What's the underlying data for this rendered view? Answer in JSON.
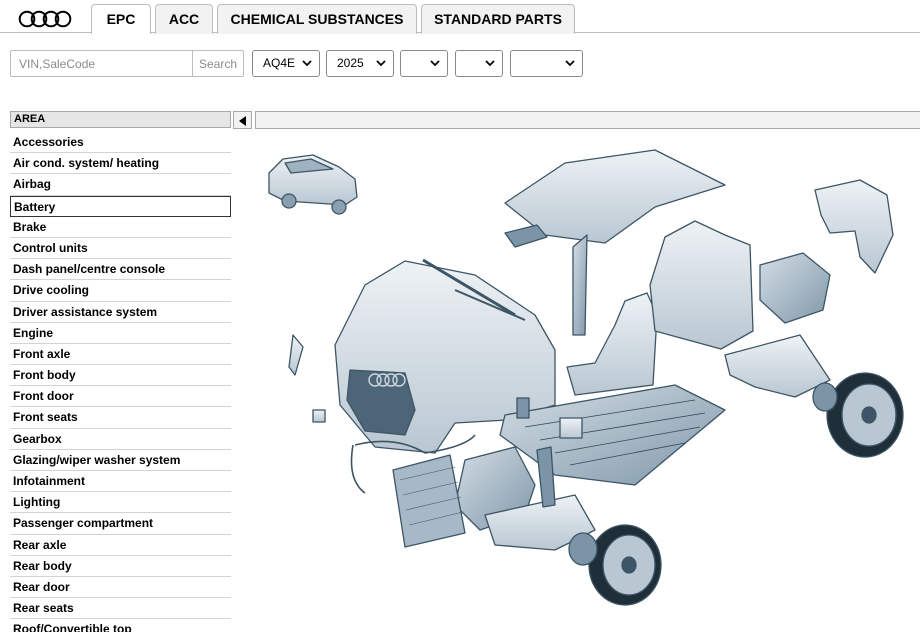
{
  "brand": {
    "logo_name": "four-rings-logo"
  },
  "tabs": [
    {
      "label": "EPC",
      "active": true
    },
    {
      "label": "ACC",
      "active": false
    },
    {
      "label": "CHEMICAL SUBSTANCES",
      "active": false
    },
    {
      "label": "STANDARD PARTS",
      "active": false
    }
  ],
  "search": {
    "placeholder": "VIN,SaleCode",
    "value": "",
    "button_label": "Search"
  },
  "filters": [
    {
      "value": "AQ4E"
    },
    {
      "value": "2025"
    },
    {
      "value": ""
    },
    {
      "value": ""
    },
    {
      "value": ""
    }
  ],
  "area": {
    "header": "AREA",
    "selected": "Battery",
    "items": [
      "Accessories",
      "Air cond. system/ heating",
      "Airbag",
      "Battery",
      "Brake",
      "Control units",
      "Dash panel/centre console",
      "Drive cooling",
      "Driver assistance system",
      "Engine",
      "Front axle",
      "Front body",
      "Front door",
      "Front seats",
      "Gearbox",
      "Glazing/wiper washer system",
      "Infotainment",
      "Lighting",
      "Passenger compartment",
      "Rear axle",
      "Rear body",
      "Rear door",
      "Rear seats",
      "Roof/Convertible top"
    ]
  },
  "colors": {
    "border": "#bdbdbd",
    "header_bg": "#e6e6e6",
    "part_fill": "#dfe6ec",
    "part_stroke": "#3d5566",
    "part_dark": "#7c95a6"
  }
}
